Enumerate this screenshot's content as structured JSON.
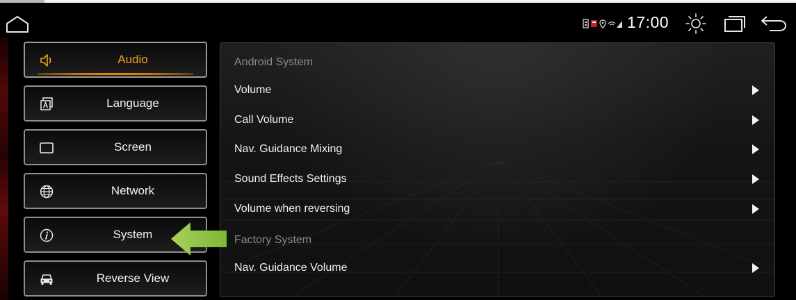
{
  "status_bar": {
    "time": "17:00",
    "icons": [
      "home-icon",
      "sd-card-icon",
      "gps-icon",
      "wifi-signal-icon",
      "brightness-icon",
      "recent-apps-icon",
      "back-icon"
    ]
  },
  "sidebar": {
    "items": [
      {
        "label": "Audio",
        "icon": "speaker-icon",
        "active": true
      },
      {
        "label": "Language",
        "icon": "language-icon",
        "active": false
      },
      {
        "label": "Screen",
        "icon": "screen-icon",
        "active": false
      },
      {
        "label": "Network",
        "icon": "globe-icon",
        "active": false
      },
      {
        "label": "System",
        "icon": "info-icon",
        "active": false
      },
      {
        "label": "Reverse View",
        "icon": "car-icon",
        "active": false
      }
    ]
  },
  "main": {
    "sections": [
      {
        "title": "Android System",
        "rows": [
          {
            "label": "Volume"
          },
          {
            "label": "Call Volume"
          },
          {
            "label": "Nav. Guidance Mixing"
          },
          {
            "label": "Sound Effects Settings"
          },
          {
            "label": "Volume when reversing"
          }
        ]
      },
      {
        "title": "Factory System",
        "rows": [
          {
            "label": "Nav. Guidance Volume"
          }
        ]
      }
    ]
  },
  "colors": {
    "accent": "#f7a21b",
    "annotation_arrow": "#8cc63f",
    "background": "#000000",
    "panel": "#181818"
  }
}
